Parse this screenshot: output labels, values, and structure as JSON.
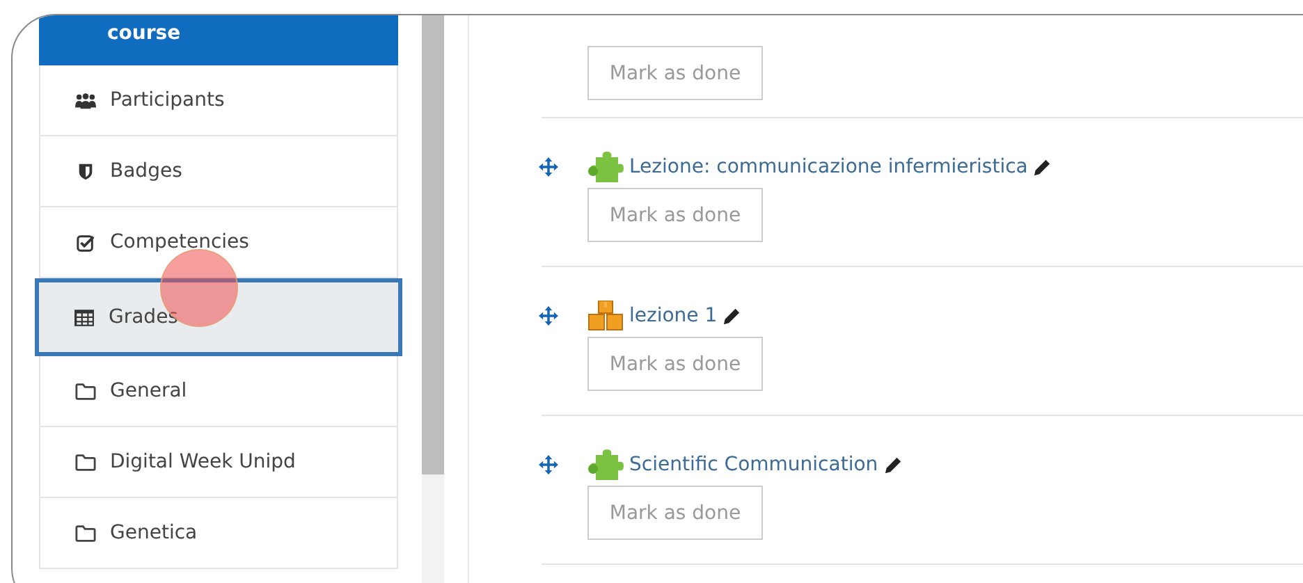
{
  "sidebar": {
    "header": "course",
    "items": [
      {
        "label": "Participants",
        "kind": "people",
        "selected": false
      },
      {
        "label": "Badges",
        "kind": "shield",
        "selected": false
      },
      {
        "label": "Competencies",
        "kind": "checkbox",
        "selected": false
      },
      {
        "label": "Grades",
        "kind": "table",
        "selected": true
      },
      {
        "label": "General",
        "kind": "folder",
        "selected": false
      },
      {
        "label": "Digital Week Unipd",
        "kind": "folder",
        "selected": false
      },
      {
        "label": "Genetica",
        "kind": "folder",
        "selected": false
      }
    ]
  },
  "activities": [
    {
      "button": "Mark as done"
    },
    {
      "title": "Lezione: communicazione infermieristica",
      "kind": "puzzle",
      "button": "Mark as done"
    },
    {
      "title": "lezione 1",
      "kind": "boxes",
      "button": "Mark as done"
    },
    {
      "title": "Scientific Communication",
      "kind": "puzzle",
      "button": "Mark as done"
    }
  ]
}
